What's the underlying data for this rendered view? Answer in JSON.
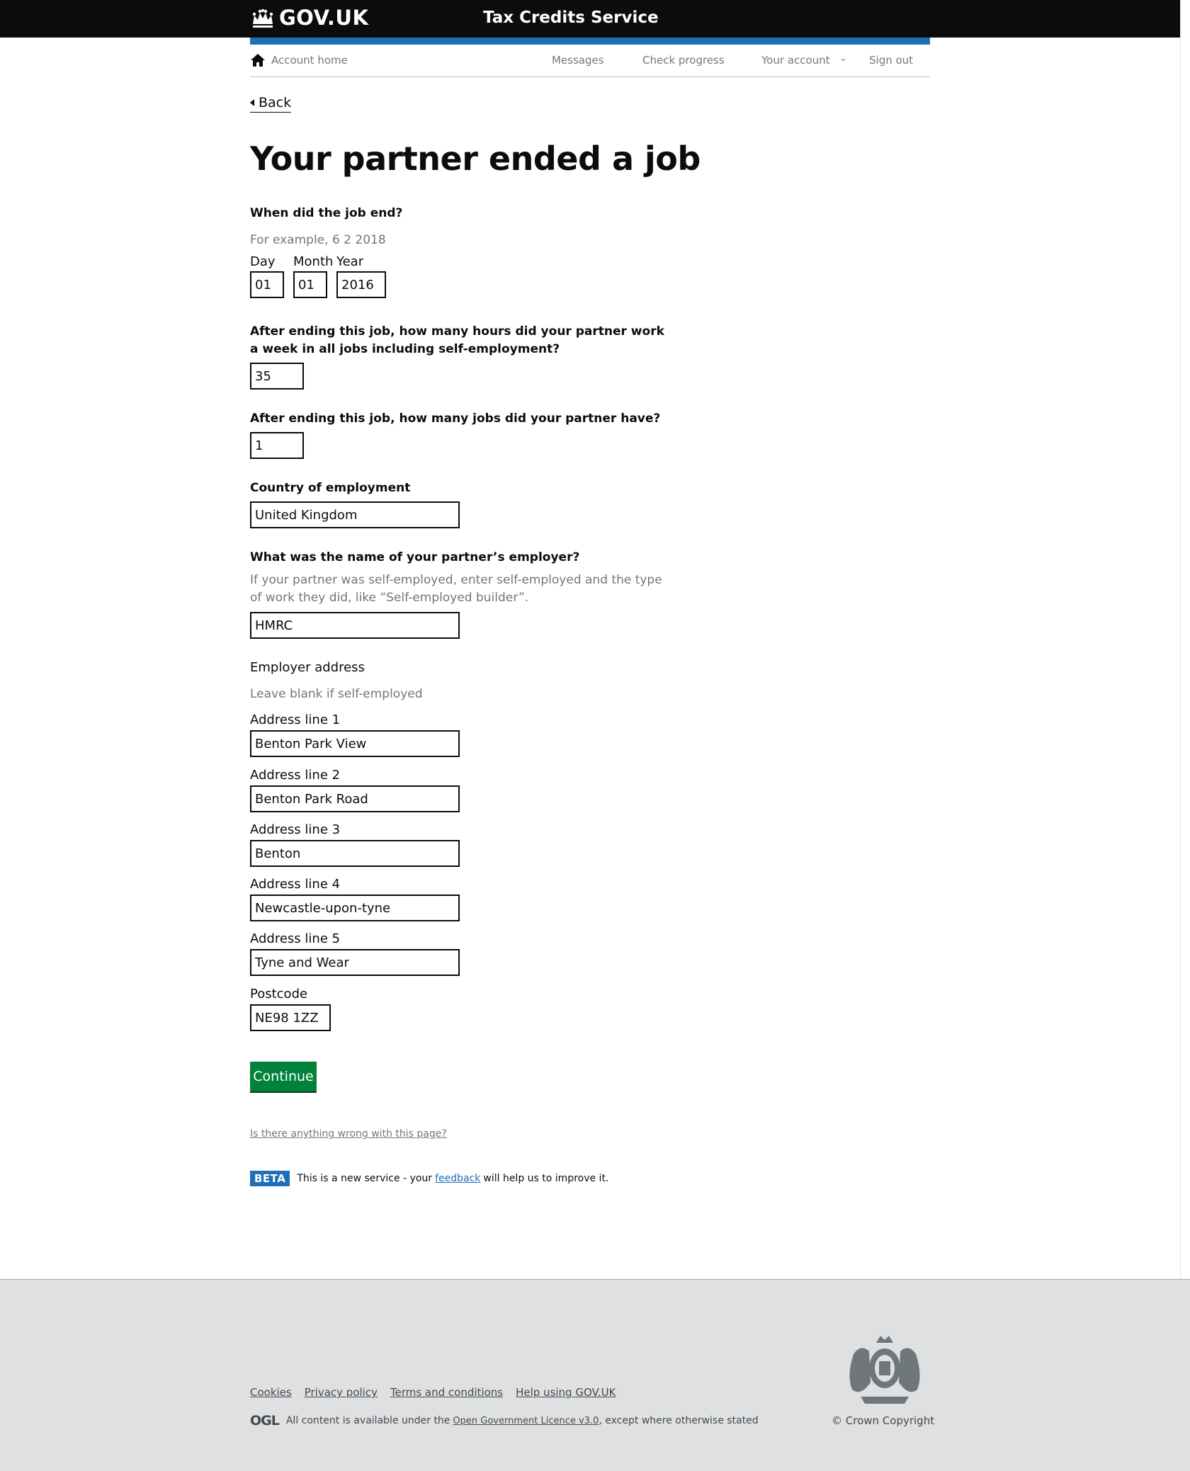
{
  "header": {
    "logo_text": "GOV.UK",
    "service_name": "Tax Credits Service"
  },
  "account_nav": {
    "home": "Account home",
    "messages": "Messages",
    "check_progress": "Check progress",
    "your_account": "Your account",
    "sign_out": "Sign out"
  },
  "back_label": "Back",
  "page_title": "Your partner ended a job",
  "date_section": {
    "question": "When did the job end?",
    "hint": "For example, 6 2 2018",
    "day_label": "Day",
    "month_label": "Month",
    "year_label": "Year",
    "day_value": "01",
    "month_value": "01",
    "year_value": "2016"
  },
  "hours_section": {
    "question": "After ending this job, how many hours did your partner work a week in all jobs including self-employment?",
    "value": "35"
  },
  "jobs_section": {
    "question": "After ending this job, how many jobs did your partner have?",
    "value": "1"
  },
  "country_section": {
    "question": "Country of employment",
    "value": "United Kingdom"
  },
  "employer_section": {
    "question": "What was the name of your partner’s employer?",
    "hint": "If your partner was self-employed, enter self-employed and the type of work they did, like “Self-employed builder”.",
    "value": "HMRC"
  },
  "address_section": {
    "title": "Employer address",
    "hint": "Leave blank if self-employed",
    "line1_label": "Address line 1",
    "line1_value": "Benton Park View",
    "line2_label": "Address line 2",
    "line2_value": "Benton Park Road",
    "line3_label": "Address line 3",
    "line3_value": "Benton",
    "line4_label": "Address line 4",
    "line4_value": "Newcastle-upon-tyne",
    "line5_label": "Address line 5",
    "line5_value": "Tyne and Wear",
    "postcode_label": "Postcode",
    "postcode_value": "NE98 1ZZ"
  },
  "continue_label": "Continue",
  "report_link": "Is there anything wrong with this page?",
  "beta": {
    "tag": "BETA",
    "text_before": "This is a new service - your",
    "link": "feedback",
    "text_after": "will help us to improve it."
  },
  "footer": {
    "links": [
      "Cookies",
      "Privacy policy",
      "Terms and conditions",
      "Help using GOV.UK"
    ],
    "ogl_mark": "OGL",
    "licence_before": "All content is available under the",
    "licence_link": "Open Government Licence v3.0",
    "licence_after": ", except where otherwise stated",
    "copyright": "© Crown Copyright"
  },
  "colors": {
    "header_bg": "#0b0c0c",
    "brand_blue": "#1d70b8",
    "button_green": "#00823b",
    "footer_bg": "#dee0e2"
  }
}
